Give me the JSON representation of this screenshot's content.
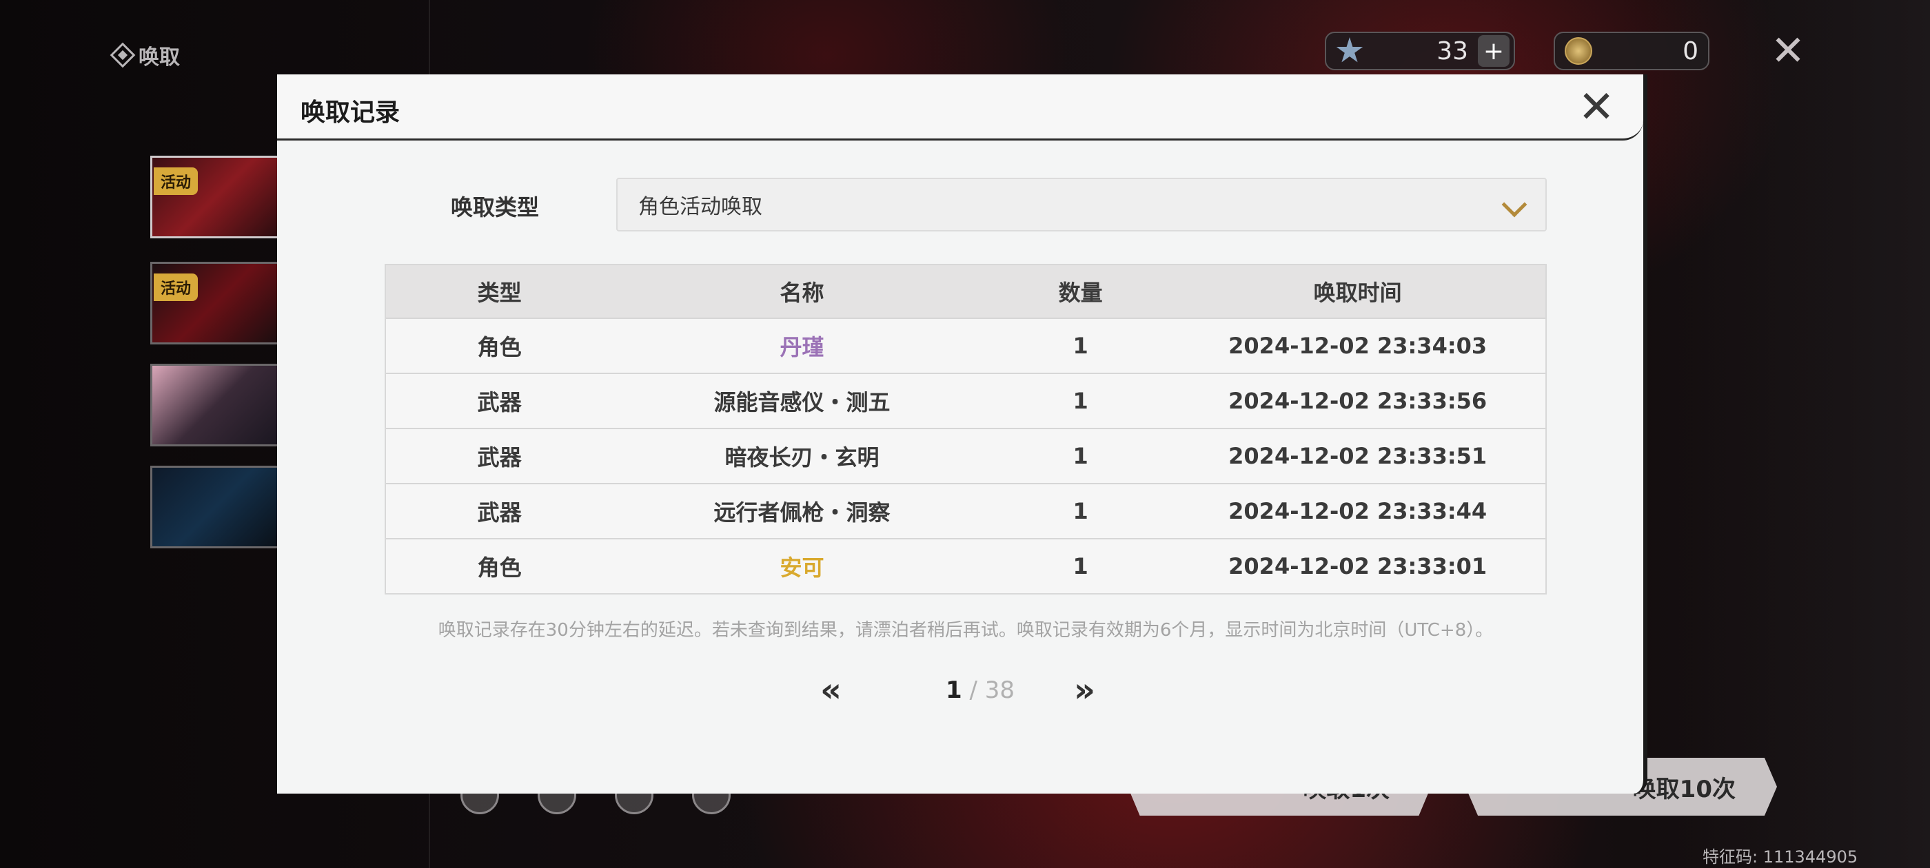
{
  "app": {
    "title": "唤取",
    "banners": [
      {
        "tag": "活动"
      },
      {
        "tag": "活动"
      },
      {
        "tag": ""
      },
      {
        "tag": ""
      }
    ],
    "currencies": [
      {
        "icon": "star-icon",
        "value": "33"
      },
      {
        "icon": "coin-icon",
        "value": "0"
      }
    ],
    "pull_buttons": [
      "唤取1次",
      "唤取10次"
    ],
    "feature_code": "特征码: 111344905"
  },
  "modal": {
    "title": "唤取记录",
    "filter": {
      "label": "唤取类型",
      "selected": "角色活动唤取"
    },
    "table": {
      "headers": [
        "类型",
        "名称",
        "数量",
        "唤取时间"
      ],
      "rows": [
        {
          "type": "角色",
          "name": "丹瑾",
          "qty": "1",
          "time": "2024-12-02 23:34:03",
          "rarity_color": "#9b72b6"
        },
        {
          "type": "武器",
          "name": "源能音感仪・测五",
          "qty": "1",
          "time": "2024-12-02 23:33:56",
          "rarity_color": "#3a3a3a"
        },
        {
          "type": "武器",
          "name": "暗夜长刃・玄明",
          "qty": "1",
          "time": "2024-12-02 23:33:51",
          "rarity_color": "#3a3a3a"
        },
        {
          "type": "武器",
          "name": "远行者佩枪・洞察",
          "qty": "1",
          "time": "2024-12-02 23:33:44",
          "rarity_color": "#3a3a3a"
        },
        {
          "type": "角色",
          "name": "安可",
          "qty": "1",
          "time": "2024-12-02 23:33:01",
          "rarity_color": "#d9a92e"
        }
      ]
    },
    "note": "唤取记录存在30分钟左右的延迟。若未查询到结果，请漂泊者稍后再试。唤取记录有效期为6个月，显示时间为北京时间（UTC+8）。",
    "pagination": {
      "current": "1",
      "separator": " / ",
      "total": "38",
      "prev_icon": "«",
      "next_icon": "»"
    }
  }
}
